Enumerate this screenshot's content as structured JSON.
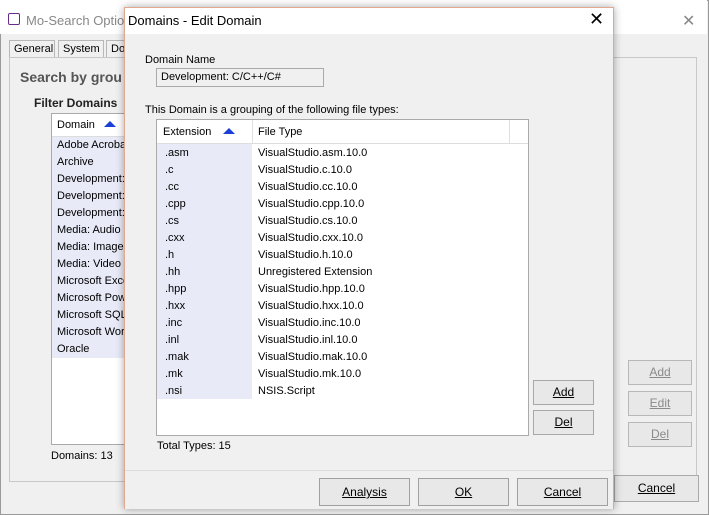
{
  "bg": {
    "title": "Mo-Search Options",
    "tabs": [
      "General",
      "System",
      "Dom"
    ],
    "heading": "Search by grou",
    "filter_label": "Filter Domains",
    "list_header": "Domain",
    "domains": [
      "Adobe Acroba",
      "Archive",
      "Development:",
      "Development:",
      "Development:",
      "Media: Audio",
      "Media: Image",
      "Media: Video",
      "Microsoft Exce",
      "Microsoft Pow",
      "Microsoft SQL",
      "Microsoft Wor",
      "Oracle"
    ],
    "count": "Domains: 13",
    "buttons": {
      "add": "Add",
      "edit": "Edit",
      "del": "Del",
      "cancel": "Cancel"
    }
  },
  "dialog": {
    "title": "Domains - Edit Domain",
    "name_label": "Domain Name",
    "name_value": "Development: C/C++/C#",
    "group_label": "This Domain is a grouping of the following file types:",
    "columns": {
      "ext": "Extension",
      "type": "File Type"
    },
    "rows": [
      {
        "ext": ".asm",
        "type": "VisualStudio.asm.10.0"
      },
      {
        "ext": ".c",
        "type": "VisualStudio.c.10.0"
      },
      {
        "ext": ".cc",
        "type": "VisualStudio.cc.10.0"
      },
      {
        "ext": ".cpp",
        "type": "VisualStudio.cpp.10.0"
      },
      {
        "ext": ".cs",
        "type": "VisualStudio.cs.10.0"
      },
      {
        "ext": ".cxx",
        "type": "VisualStudio.cxx.10.0"
      },
      {
        "ext": ".h",
        "type": "VisualStudio.h.10.0"
      },
      {
        "ext": ".hh",
        "type": "Unregistered Extension"
      },
      {
        "ext": ".hpp",
        "type": "VisualStudio.hpp.10.0"
      },
      {
        "ext": ".hxx",
        "type": "VisualStudio.hxx.10.0"
      },
      {
        "ext": ".inc",
        "type": "VisualStudio.inc.10.0"
      },
      {
        "ext": ".inl",
        "type": "VisualStudio.inl.10.0"
      },
      {
        "ext": ".mak",
        "type": "VisualStudio.mak.10.0"
      },
      {
        "ext": ".mk",
        "type": "VisualStudio.mk.10.0"
      },
      {
        "ext": ".nsi",
        "type": "NSIS.Script"
      }
    ],
    "total": "Total Types: 15",
    "buttons": {
      "add": "Add",
      "del": "Del",
      "analysis": "Analysis",
      "ok": "OK",
      "cancel": "Cancel"
    }
  },
  "colors": {
    "accent": "#1a3fd6",
    "row_highlight": "#e8eaf8",
    "dialog_border": "#e0a890"
  }
}
